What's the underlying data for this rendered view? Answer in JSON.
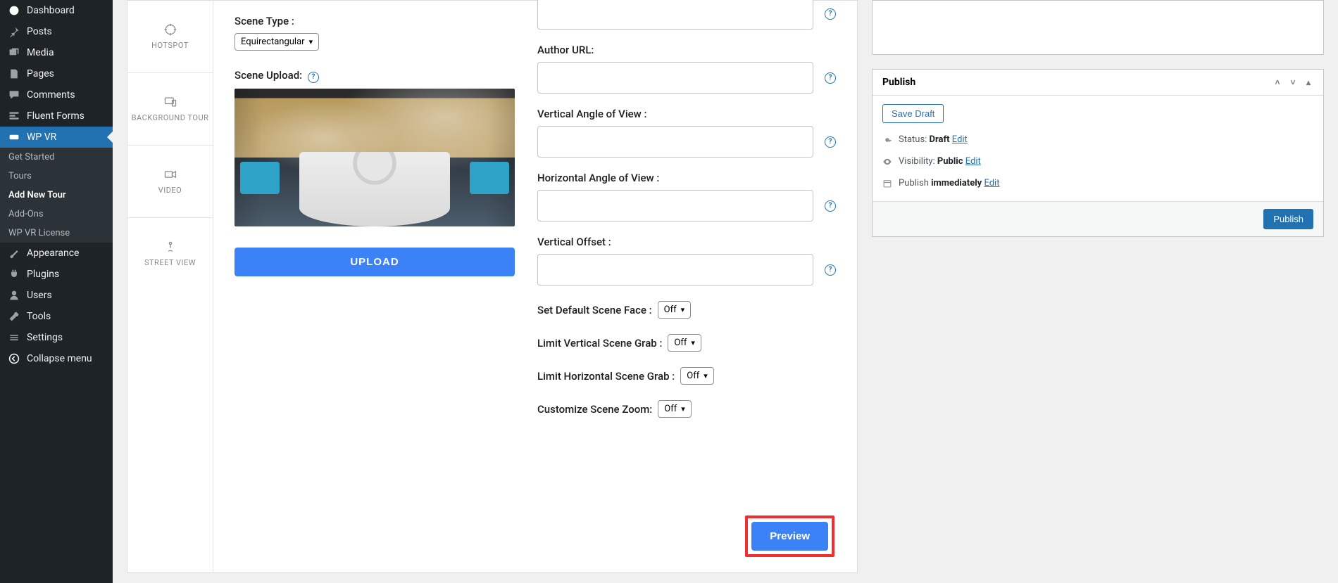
{
  "sidebar": {
    "items": [
      {
        "label": "Dashboard"
      },
      {
        "label": "Posts"
      },
      {
        "label": "Media"
      },
      {
        "label": "Pages"
      },
      {
        "label": "Comments"
      },
      {
        "label": "Fluent Forms"
      },
      {
        "label": "WP VR"
      },
      {
        "label": "Appearance"
      },
      {
        "label": "Plugins"
      },
      {
        "label": "Users"
      },
      {
        "label": "Tools"
      },
      {
        "label": "Settings"
      },
      {
        "label": "Collapse menu"
      }
    ],
    "submenu": [
      {
        "label": "Get Started"
      },
      {
        "label": "Tours"
      },
      {
        "label": "Add New Tour"
      },
      {
        "label": "Add-Ons"
      },
      {
        "label": "WP VR License"
      }
    ]
  },
  "vert_tabs": {
    "hotspot": "HOTSPOT",
    "bgtour": "BACKGROUND TOUR",
    "video": "VIDEO",
    "street": "STREET VIEW"
  },
  "scene": {
    "scene_type_label": "Scene Type :",
    "scene_type_value": "Equirectangular",
    "scene_upload_label": "Scene Upload:",
    "upload_button": "UPLOAD",
    "author_url_label": "Author URL:",
    "vaov_label": "Vertical Angle of View :",
    "haov_label": "Horizontal Angle of View :",
    "voffset_label": "Vertical Offset :",
    "default_face_label": "Set Default Scene Face :",
    "limit_v_grab_label": "Limit Vertical Scene Grab :",
    "limit_h_grab_label": "Limit Horizontal Scene Grab :",
    "custom_zoom_label": "Customize Scene Zoom:",
    "off_value": "Off",
    "preview_label": "Preview"
  },
  "publish": {
    "title": "Publish",
    "save_draft": "Save Draft",
    "status_label": "Status: ",
    "status_value": "Draft",
    "visibility_label": "Visibility: ",
    "visibility_value": "Public",
    "publish_label": "Publish ",
    "publish_value": "immediately",
    "edit": "Edit",
    "publish_button": "Publish"
  }
}
